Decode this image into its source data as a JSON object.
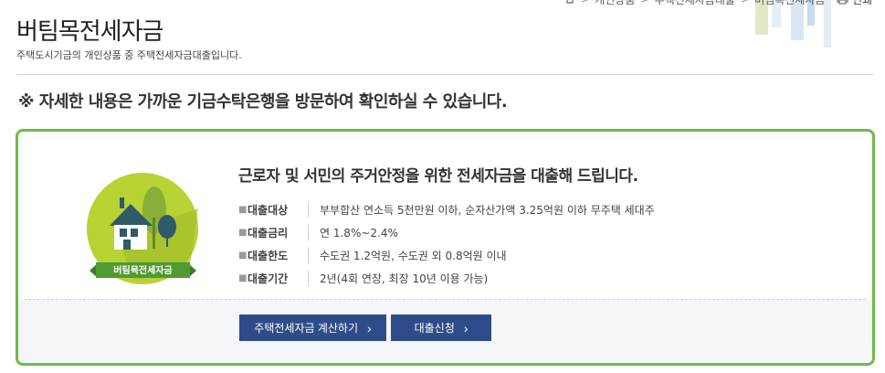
{
  "breadcrumb": {
    "home_icon": "home-icon",
    "items": [
      "개인상품",
      "주택전세자금대출",
      "버팀목전세자금"
    ]
  },
  "print": {
    "icon": "print-icon",
    "label": "인쇄"
  },
  "page": {
    "title": "버팀목전세자금",
    "subtitle": "주택도시기금의 개인상품 중 주택전세자금대출입니다."
  },
  "notice": "※ 자세한 내용은 가까운 기금수탁은행을 방문하여 확인하실 수 있습니다.",
  "card": {
    "logo_label": "버팀목전세자금",
    "headline": "근로자 및 서민의 주거안정을 위한 전세자금을 대출해 드립니다.",
    "info": [
      {
        "key": "대출대상",
        "value": "부부합산 연소득 5천만원 이하, 순자산가액 3.25억원 이하 무주택 세대주"
      },
      {
        "key": "대출금리",
        "value": "연 1.8%~2.4%"
      },
      {
        "key": "대출한도",
        "value": "수도권 1.2억원, 수도권 외 0.8억원 이내"
      },
      {
        "key": "대출기간",
        "value": "2년(4회 연장, 최장 10년 이용 가능)"
      }
    ],
    "buttons": {
      "calc": "주택전세자금 계산하기",
      "apply": "대출신청"
    }
  },
  "colors": {
    "accent_green": "#72b84b",
    "button_blue": "#2f4c8a"
  }
}
